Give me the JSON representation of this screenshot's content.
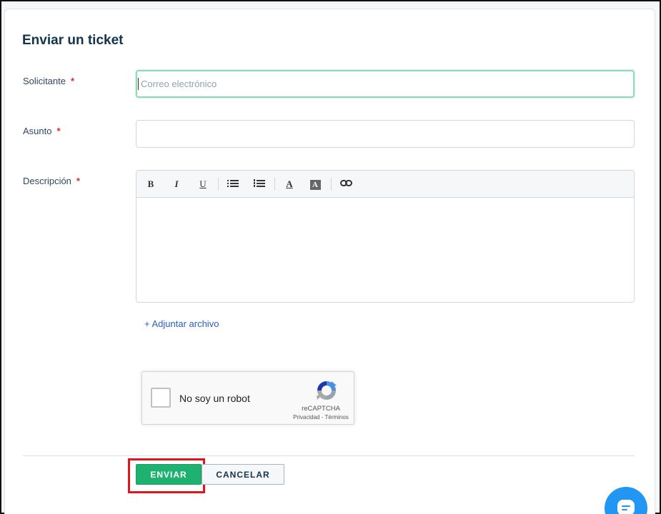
{
  "form": {
    "title": "Enviar un ticket",
    "required_mark": "*",
    "requester": {
      "label": "Solicitante",
      "placeholder": "Correo electrónico",
      "value": ""
    },
    "subject": {
      "label": "Asunto",
      "value": ""
    },
    "description": {
      "label": "Descripción",
      "value": ""
    },
    "toolbar": {
      "bold": "B",
      "italic": "I",
      "underline": "U",
      "unordered_list_icon": "bullet-list-icon",
      "ordered_list_icon": "numbered-list-icon",
      "font_color": "A",
      "background_color": "A",
      "link_icon": "link-icon"
    },
    "attach_label": "+ Adjuntar archivo",
    "captcha": {
      "label": "No soy un robot",
      "brand": "reCAPTCHA",
      "privacy": "Privacidad",
      "separator": " - ",
      "terms": "Términos"
    },
    "submit_label": "ENVIAR",
    "cancel_label": "CANCELAR"
  },
  "colors": {
    "submit_bg": "#1eb170",
    "focus_border": "#8fdbb4",
    "link": "#2c5cc5",
    "required": "#d72d30",
    "highlight": "#e3141b",
    "chat_bubble": "#2196f3"
  }
}
